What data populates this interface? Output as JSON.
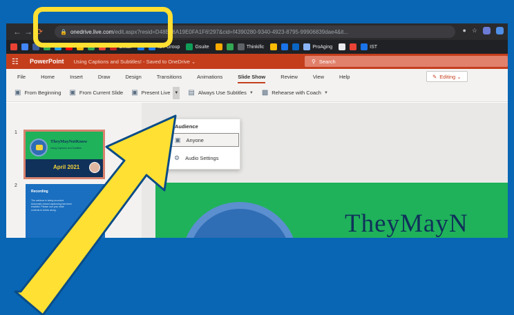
{
  "browser": {
    "url_host": "onedrive.live.com",
    "url_rest": "/edit.aspx?resid=D48E26A19E0FA1F6!297&cid=f4390280-9340-4923-8795-99906839dae4&it...",
    "bookmarks": [
      "Gmail",
      "IST Group",
      "Gsuite",
      "Thinkific",
      "ProAging",
      "IST"
    ]
  },
  "app": {
    "name": "PowerPoint",
    "doc_title": "Using Captions and Subtitles! - Saved to OneDrive ⌄",
    "search_placeholder": "Search"
  },
  "ribbon": {
    "tabs": [
      "File",
      "Home",
      "Insert",
      "Draw",
      "Design",
      "Transitions",
      "Animations",
      "Slide Show",
      "Review",
      "View",
      "Help"
    ],
    "active_tab": "Slide Show",
    "editing_label": "Editing ⌄",
    "commands": {
      "from_beginning": "From Beginning",
      "from_current": "From Current Slide",
      "present_live": "Present Live",
      "always_subtitles": "Always Use Subtitles",
      "rehearse": "Rehearse with Coach"
    }
  },
  "dropdown": {
    "header": "Audience",
    "items": [
      "Anyone",
      "Audio Settings"
    ]
  },
  "slides": {
    "numbers": [
      "1",
      "2"
    ],
    "thumb1_title": "TheyMayNotKnow",
    "thumb1_sub": "Using Captions and Subtitles",
    "thumb1_date": "April 2021",
    "thumb2_head": "Recording",
    "thumb2_body": "The webinar is being recorded. Automatic closed captioning has been enabled. Please use your slide controls to follow along.",
    "main_title": "TheyMayN"
  },
  "colors": {
    "background": "#0866b4",
    "highlight": "#ffe033",
    "powerpoint": "#c43e1c",
    "slide_green": "#1fb25a"
  }
}
